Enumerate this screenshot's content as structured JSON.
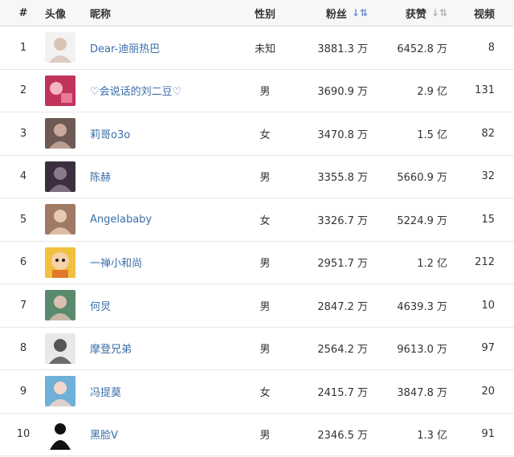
{
  "header": {
    "rank": "#",
    "avatar": "头像",
    "nickname": "昵称",
    "gender": "性别",
    "fans": "粉丝",
    "likes": "获赞",
    "videos": "视频",
    "sort_icon": "↓",
    "sort_icon_glyph": "↓⇅"
  },
  "rows": [
    {
      "rank": "1",
      "nickname": "Dear-迪丽热巴",
      "gender": "未知",
      "fans": "3881.3 万",
      "likes": "6452.8 万",
      "videos": "8",
      "avatar": {
        "bg": "#f2f2f2",
        "fg": "#d9c5b8",
        "icon": "portrait-woman-white"
      }
    },
    {
      "rank": "2",
      "nickname": "♡会说话的刘二豆♡",
      "gender": "男",
      "fans": "3690.9 万",
      "likes": "2.9 亿",
      "videos": "131",
      "avatar": {
        "bg": "#c0335a",
        "fg": "#f3b5c4",
        "icon": "pink-photo"
      }
    },
    {
      "rank": "3",
      "nickname": "莉哥o3o",
      "gender": "女",
      "fans": "3470.8 万",
      "likes": "1.5 亿",
      "videos": "82",
      "avatar": {
        "bg": "#6e5a55",
        "fg": "#c9a99b",
        "icon": "portrait-woman-dark"
      }
    },
    {
      "rank": "4",
      "nickname": "陈赫",
      "gender": "男",
      "fans": "3355.8 万",
      "likes": "5660.9 万",
      "videos": "32",
      "avatar": {
        "bg": "#3b2f3f",
        "fg": "#8a7a8a",
        "icon": "portrait-man-dark"
      }
    },
    {
      "rank": "5",
      "nickname": "Angelababy",
      "gender": "女",
      "fans": "3326.7 万",
      "likes": "5224.9 万",
      "videos": "15",
      "avatar": {
        "bg": "#a07a62",
        "fg": "#e8c9b2",
        "icon": "portrait-woman-warm"
      }
    },
    {
      "rank": "6",
      "nickname": "一禅小和尚",
      "gender": "男",
      "fans": "2951.7 万",
      "likes": "1.2 亿",
      "videos": "212",
      "avatar": {
        "bg": "#f0c040",
        "fg": "#e07a2a",
        "icon": "cartoon-monk"
      }
    },
    {
      "rank": "7",
      "nickname": "何炅",
      "gender": "男",
      "fans": "2847.2 万",
      "likes": "4639.3 万",
      "videos": "10",
      "avatar": {
        "bg": "#5a8a6e",
        "fg": "#d9c0b0",
        "icon": "portrait-man-green"
      }
    },
    {
      "rank": "8",
      "nickname": "摩登兄弟",
      "gender": "男",
      "fans": "2564.2 万",
      "likes": "9613.0 万",
      "videos": "97",
      "avatar": {
        "bg": "#e8e8e8",
        "fg": "#555555",
        "icon": "portrait-man-grey"
      }
    },
    {
      "rank": "9",
      "nickname": "冯提莫",
      "gender": "女",
      "fans": "2415.7 万",
      "likes": "3847.8 万",
      "videos": "20",
      "avatar": {
        "bg": "#6fb0d8",
        "fg": "#f2d6c8",
        "icon": "portrait-woman-blue"
      }
    },
    {
      "rank": "10",
      "nickname": "黑脸V",
      "gender": "男",
      "fans": "2346.5 万",
      "likes": "1.3 亿",
      "videos": "91",
      "avatar": {
        "bg": "#ffffff",
        "fg": "#111111",
        "icon": "silhouette-black"
      }
    }
  ]
}
